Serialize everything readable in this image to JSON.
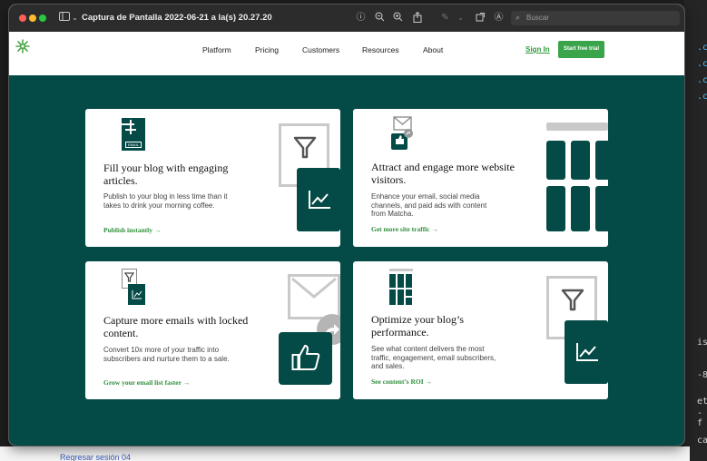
{
  "window": {
    "title": "Captura de Pantalla 2022-06-21 a la(s) 20.27.20",
    "search_placeholder": "Buscar"
  },
  "nav": {
    "links": [
      "Platform",
      "Pricing",
      "Customers",
      "Resources",
      "About"
    ],
    "sign_in": "Sign In",
    "cta": "Start free trial"
  },
  "cards": [
    {
      "title": "Fill your blog with engaging articles.",
      "description": "Publish to your blog in less time than it takes to drink your morning coffee.",
      "link": "Publish instantly →",
      "illustration_label": "EMAIL"
    },
    {
      "title": "Attract and engage more website visitors.",
      "description": "Enhance your email, social media channels, and paid ads with content from Matcha.",
      "link": "Get more site traffic →"
    },
    {
      "title": "Capture more emails with locked content.",
      "description": "Convert 10x more of your traffic into subscribers and nurture them to a sale.",
      "link": "Grow your email list faster →"
    },
    {
      "title": "Optimize your blog’s performance.",
      "description": "See what content delivers the most traffic, engagement, email subscribers, and sales.",
      "link": "See content’s ROI →"
    }
  ],
  "background": {
    "code_lines": [
      ".c",
      ".c",
      ".c",
      ".c",
      "is",
      "-8",
      "et",
      "-f",
      "ca"
    ],
    "bottom_text": "Regresar sesión 04"
  },
  "colors": {
    "brand_teal": "#044a46",
    "brand_green": "#3aa44a",
    "link_green": "#2f8f3a"
  },
  "icons": [
    "sidebar-toggle-icon",
    "chevron-down-icon",
    "info-icon",
    "zoom-out-icon",
    "zoom-in-icon",
    "share-icon",
    "markup-icon",
    "rotate-icon",
    "annotate-icon",
    "search-icon",
    "matcha-logo-icon"
  ]
}
